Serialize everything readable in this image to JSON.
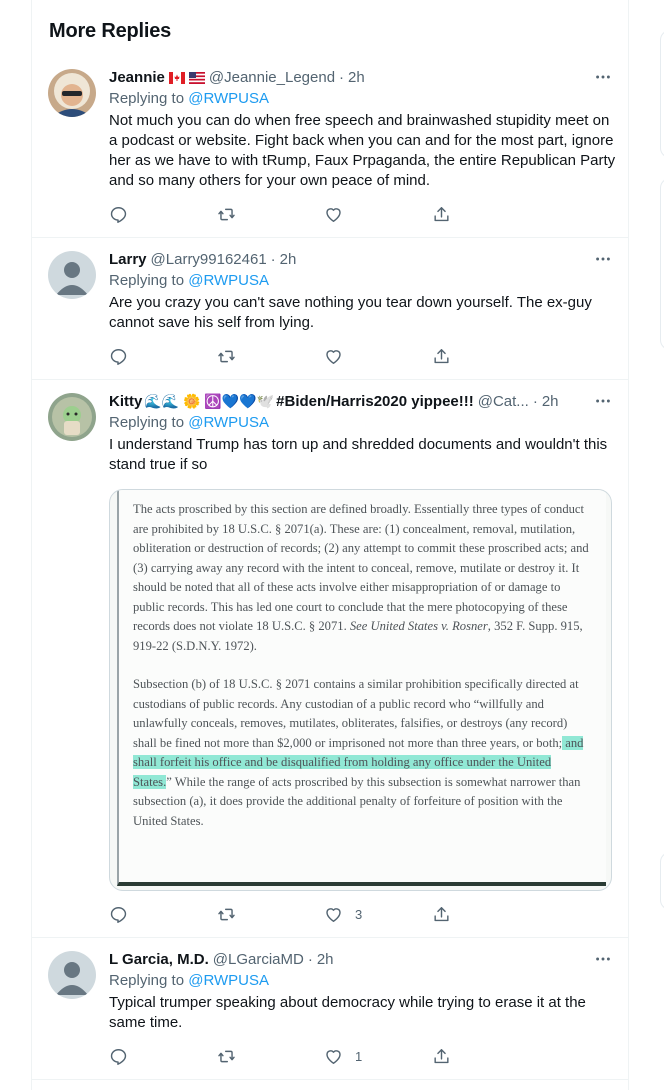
{
  "section_title": "More Replies",
  "tweets": [
    {
      "name": "Jeannie",
      "handle": "@Jeannie_Legend",
      "time": "2h",
      "replying_prefix": "Replying to",
      "replying_to": "@RWPUSA",
      "text": "Not much you can do when free speech and brainwashed stupidity meet on a podcast or website.  Fight back when you can and for the most part, ignore her as we have to with tRump, Faux Prpaganda, the entire Republican Party and so many others for your own peace of mind.",
      "likes": ""
    },
    {
      "name": "Larry",
      "handle": "@Larry99162461",
      "time": "2h",
      "replying_prefix": "Replying to",
      "replying_to": "@RWPUSA",
      "text": "Are you crazy you can't save nothing you tear down yourself. The ex-guy cannot save his self from lying.",
      "likes": ""
    },
    {
      "name": "Kitty",
      "name_emoji": "🌊🌊 🌼 ☮️💙💙🕊️",
      "name_tag": "#Biden/Harris2020 yippee!!!",
      "handle": "@Cat...",
      "time": "2h",
      "replying_prefix": "Replying to",
      "replying_to": "@RWPUSA",
      "text": "I understand Trump has torn up and shredded documents and wouldn't this stand true if so",
      "likes": "3",
      "document": {
        "para1": "The acts proscribed by this section are defined broadly. Essentially three types of conduct are prohibited by 18 U.S.C. § 2071(a). These are: (1) concealment, removal, mutilation, obliteration or destruction of records; (2) any attempt to commit these proscribed acts; and (3) carrying away any record with the intent to conceal, remove, mutilate or destroy it. It should be noted that all of these acts involve either misappropriation of or damage to public records. This has led one court to conclude that the mere photocopying of these records does not violate 18 U.S.C. § 2071.",
        "para1_cite": "See United States v. Rosner",
        "para1_end": ", 352 F. Supp. 915, 919-22 (S.D.N.Y. 1972).",
        "para2_start": "Subsection (b) of 18 U.S.C. § 2071 contains a similar prohibition specifically directed at custodians of public records. Any custodian of a public record who “willfully and unlawfully conceals, removes, mutilates, obliterates, falsifies, or destroys (any record) shall be fined not more than $2,000 or imprisoned not more than three years, or both;",
        "para2_highlight": " and shall forfeit his office and be disqualified from holding any office under the United States.",
        "para2_end": "” While the range of acts proscribed by this subsection is somewhat narrower than subsection (a), it does provide the additional penalty of forfeiture of position with the United States."
      }
    },
    {
      "name": "L Garcia, M.D.",
      "handle": "@LGarciaMD",
      "time": "2h",
      "replying_prefix": "Replying to",
      "replying_to": "@RWPUSA",
      "text": "Typical trumper speaking about democracy while trying to erase it at the same time.",
      "likes": "1"
    }
  ],
  "icons": {
    "reply": "reply-icon",
    "retweet": "retweet-icon",
    "like": "heart-icon",
    "share": "share-icon",
    "more": "more-icon"
  },
  "colors": {
    "link": "#1d9bf0",
    "secondary_text": "#536471",
    "border": "#eff3f4",
    "highlight": "#6ee1c8"
  }
}
